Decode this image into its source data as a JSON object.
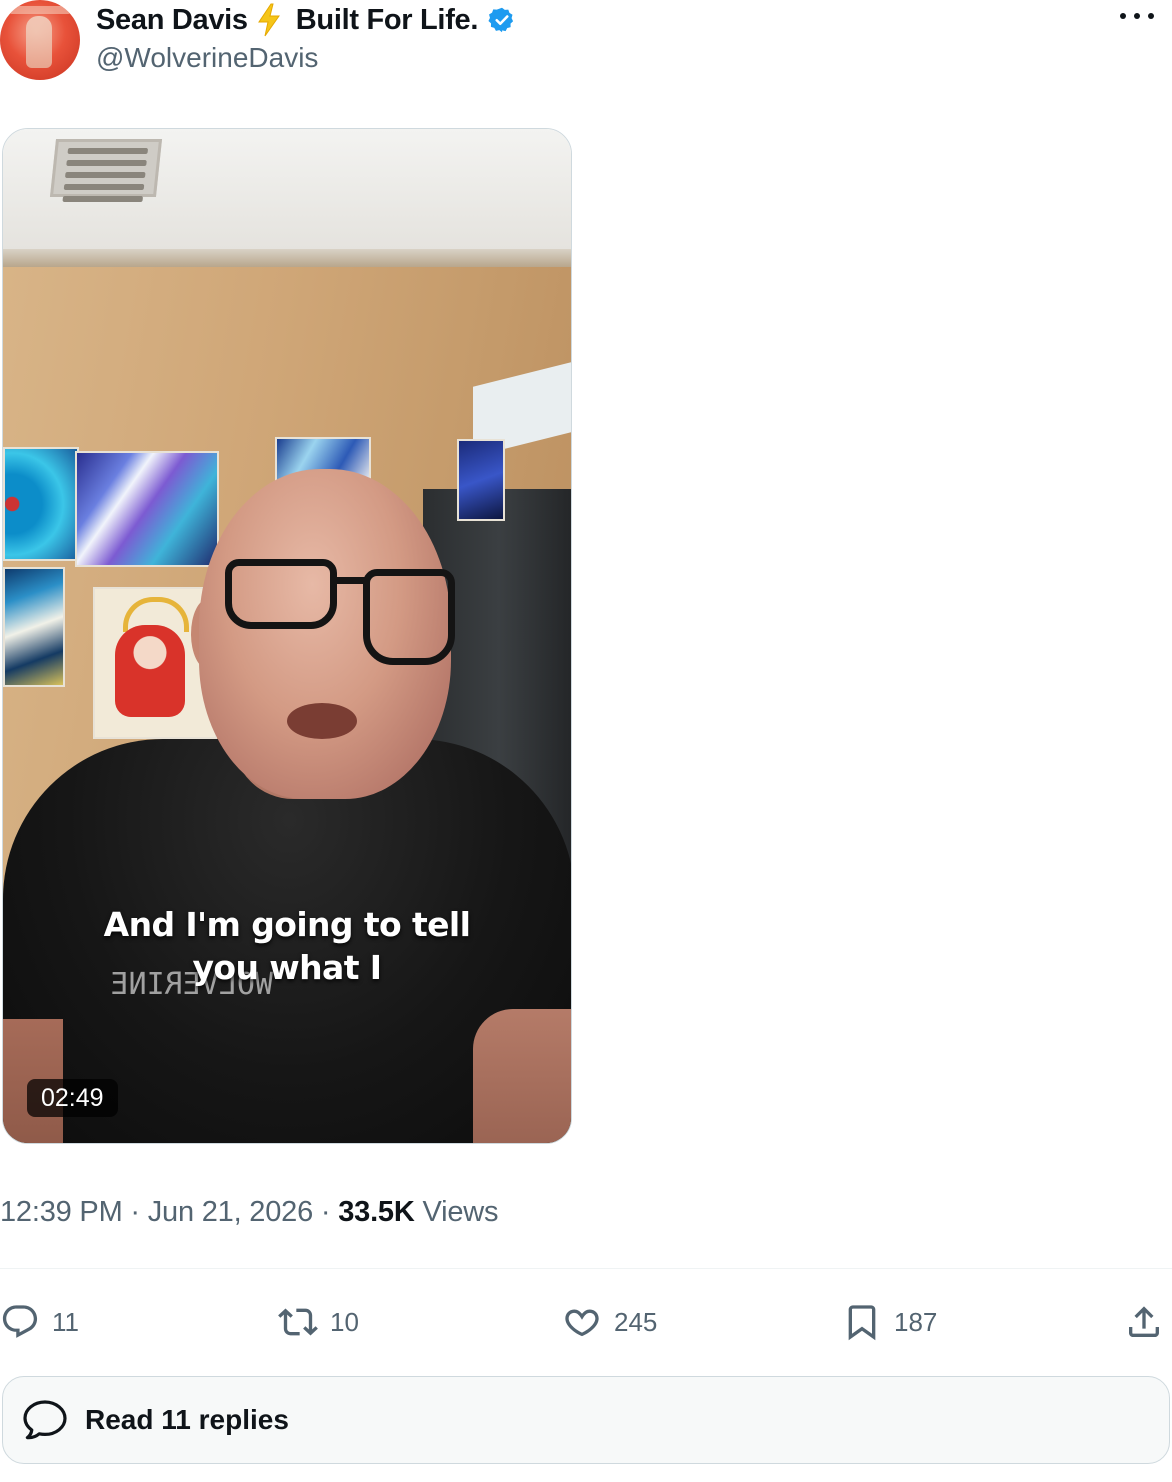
{
  "post": {
    "author_name": "Sean Davis",
    "bolt_emoji": "⚡",
    "author_tagline": "Built For Life.",
    "handle": "@WolverineDavis",
    "verified_icon": "verified-badge-icon",
    "more_icon": "more-options-icon"
  },
  "video": {
    "caption_line1": "And I'm going to tell",
    "caption_line2": "you what I",
    "duration": "02:49",
    "shirt_text": "WOLVERINE"
  },
  "meta": {
    "time": "12:39 PM",
    "separator": "·",
    "date": "Jun 21, 2026",
    "views_count": "33.5K",
    "views_label": "Views"
  },
  "actions": {
    "reply_count": "11",
    "repost_count": "10",
    "like_count": "245",
    "bookmark_count": "187"
  },
  "read_replies": {
    "label": "Read 11 replies"
  },
  "colors": {
    "text_primary": "#0f1419",
    "text_secondary": "#536471",
    "verified_blue": "#1d9bf0",
    "border": "#cfd9de"
  }
}
